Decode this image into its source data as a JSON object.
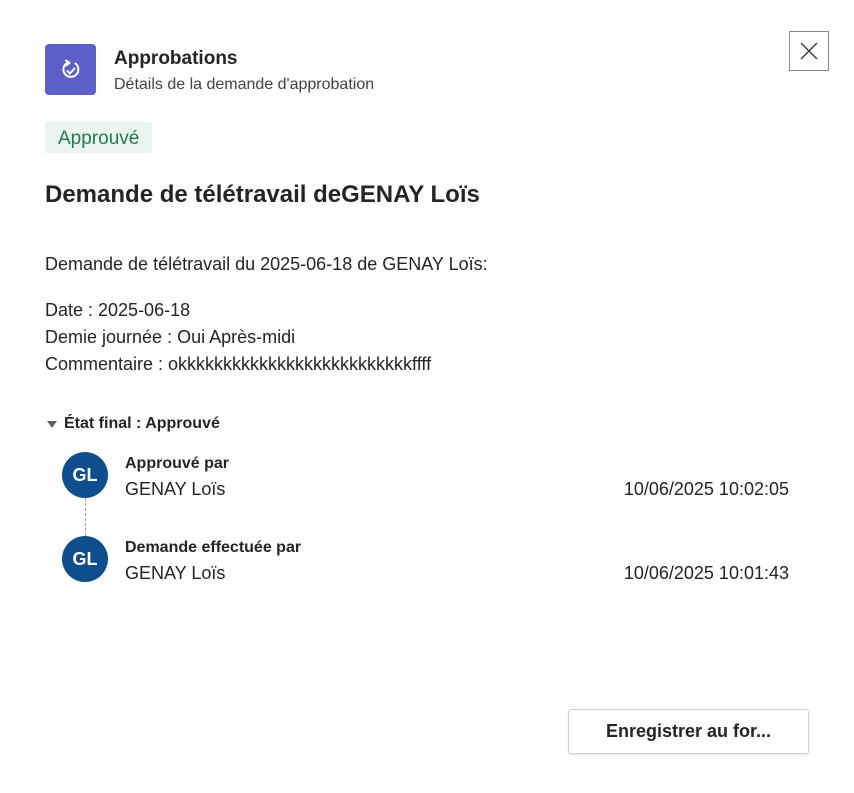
{
  "header": {
    "app_icon": "approvals-icon",
    "title": "Approbations",
    "subtitle": "Détails de la demande d'approbation",
    "close_icon": "close-icon"
  },
  "status": {
    "label": "Approuvé",
    "color": "#237b4b",
    "background": "#e9f5ee"
  },
  "request": {
    "title": "Demande de télétravail deGENAY Loïs",
    "intro": "Demande de télétravail du 2025-06-18 de GENAY Loïs:",
    "date_line": "Date : 2025-06-18",
    "half_day_line": "Demie journée : Oui Après-midi",
    "comment_line": "Commentaire : okkkkkkkkkkkkkkkkkkkkkkkkkkffff"
  },
  "final_state": {
    "label": "État final : Approuvé",
    "icon": "caret-down-icon"
  },
  "timeline": [
    {
      "initials": "GL",
      "label": "Approuvé par",
      "name": "GENAY Loïs",
      "timestamp": "10/06/2025 10:02:05"
    },
    {
      "initials": "GL",
      "label": "Demande effectuée par",
      "name": "GENAY Loïs",
      "timestamp": "10/06/2025 10:01:43"
    }
  ],
  "footer": {
    "save_label": "Enregistrer au for..."
  },
  "colors": {
    "accent": "#5b5fc7",
    "avatar": "#0f4e8c"
  }
}
